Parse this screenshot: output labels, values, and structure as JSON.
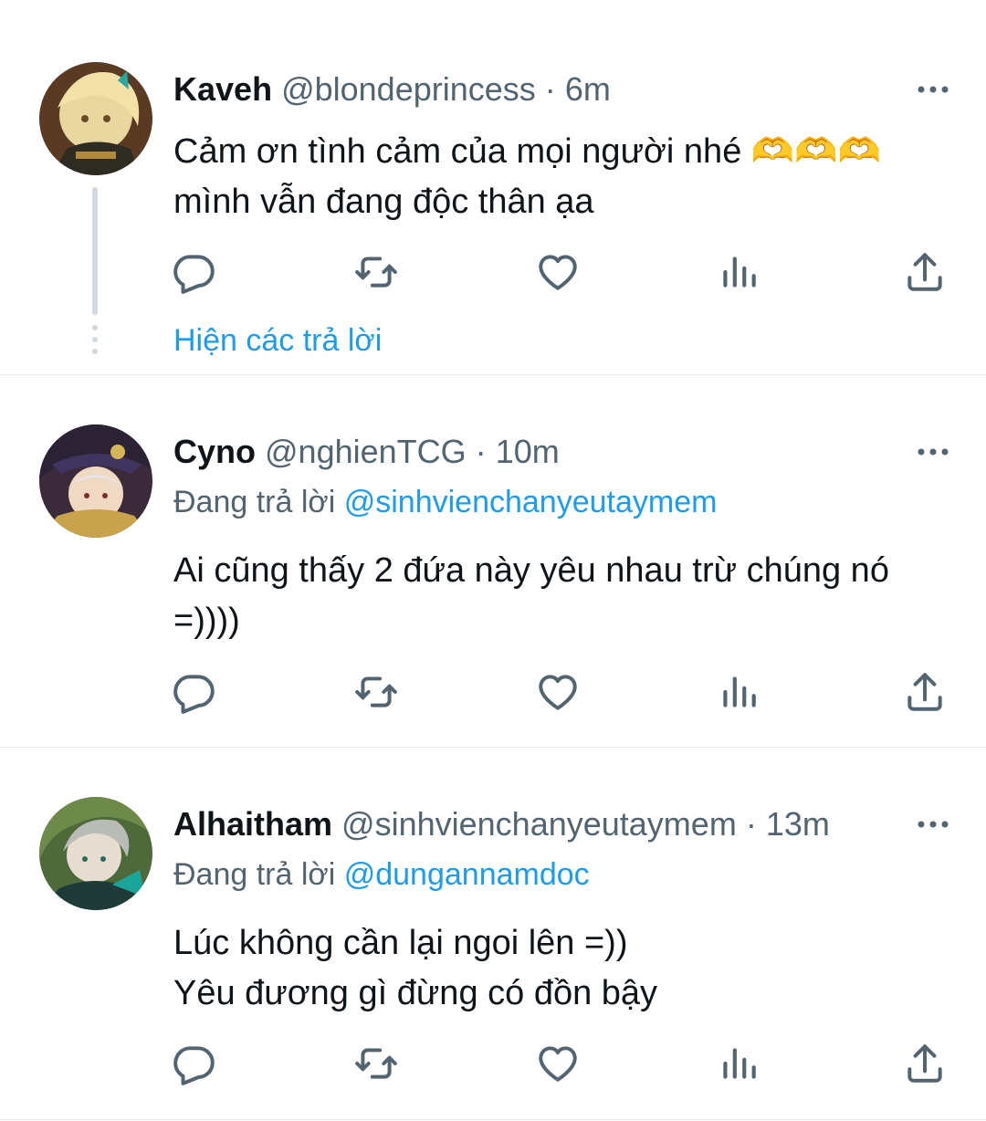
{
  "tweets": [
    {
      "name": "Kaveh",
      "handle": "@blondeprincess",
      "sep": "·",
      "time": "6m",
      "text": "Cảm ơn tình cảm của mọi người nhé 🫶🫶🫶\nmình vẫn đang độc thân ạa",
      "show_replies": "Hiện các trả lời",
      "avatar_icon": "avatar-kaveh-icon"
    },
    {
      "name": "Cyno",
      "handle": "@nghienTCG",
      "sep": "·",
      "time": "10m",
      "replying_prefix": "Đang trả lời",
      "replying_to": "@sinhvienchanyeutaymem",
      "text": "Ai cũng thấy 2 đứa này yêu nhau trừ chúng nó\n=))))",
      "avatar_icon": "avatar-cyno-icon"
    },
    {
      "name": "Alhaitham",
      "handle": "@sinhvienchanyeutaymem",
      "sep": "·",
      "time": "13m",
      "replying_prefix": "Đang trả lời",
      "replying_to": "@dungannamdoc",
      "text": "Lúc không cần lại ngoi lên =))\nYêu đương gì đừng có đồn bậy",
      "avatar_icon": "avatar-alhaitham-icon"
    }
  ],
  "icons": {
    "reply": "reply-icon",
    "retweet": "retweet-icon",
    "like": "heart-icon",
    "views": "analytics-icon",
    "share": "share-icon",
    "more": "more-options-icon"
  },
  "colors": {
    "accent": "#1d9bf0",
    "muted": "#536471",
    "icon": "#536471",
    "divider": "#e6e9eb",
    "thread": "#cfd9de"
  }
}
